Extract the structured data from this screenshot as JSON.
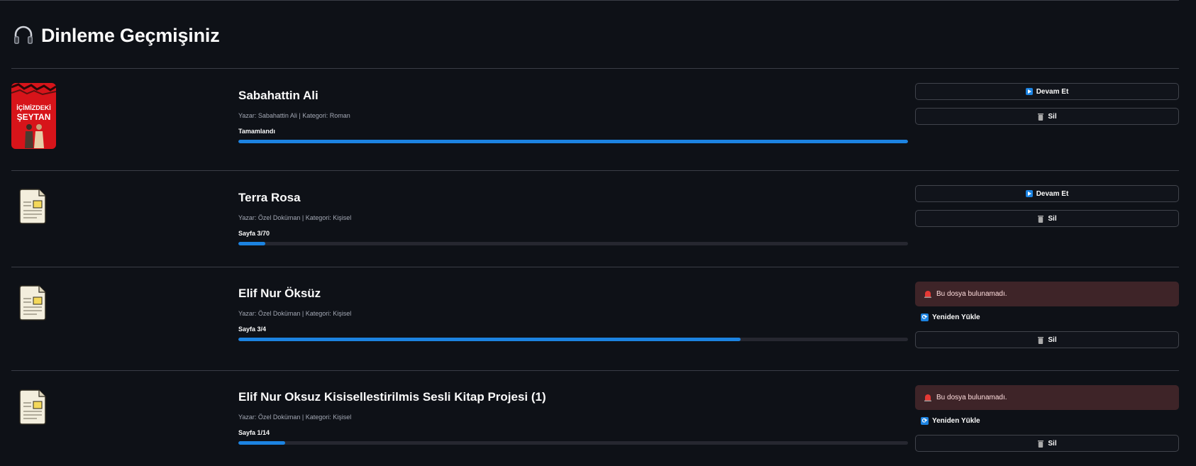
{
  "header": {
    "title": "Dinleme Geçmişiniz",
    "icon": "headphones-icon"
  },
  "entries": [
    {
      "title": "Sabahattin Ali",
      "meta": "Yazar: Sabahattin Ali | Kategori: Roman",
      "status": "Tamamlandı",
      "progress": 1.0,
      "cover_text": [
        "İÇİMİZDEKİ",
        "ŞEYTAN"
      ],
      "cover_color": "#d7141a",
      "continue_label": "Devam Et",
      "delete_label": "Sil"
    },
    {
      "title": "Terra Rosa",
      "meta": "Yazar: Özel Doküman | Kategori: Kişisel",
      "status": "Sayfa 3/70",
      "progress": 0.04,
      "continue_label": "Devam Et",
      "delete_label": "Sil"
    },
    {
      "title": "Elif Nur Öksüz",
      "meta": "Yazar: Özel Doküman | Kategori: Kişisel",
      "status": "Sayfa 3/4",
      "progress": 0.75,
      "error": "Bu dosya bulunamadı.",
      "reload_label": "Yeniden Yükle",
      "delete_label": "Sil"
    },
    {
      "title": "Elif Nur Oksuz Kisisellestirilmis Sesli Kitap Projesi (1)",
      "meta": "Yazar: Özel Doküman | Kategori: Kişisel",
      "status": "Sayfa 1/14",
      "progress": 0.07,
      "error": "Bu dosya bulunamadı.",
      "reload_label": "Yeniden Yükle",
      "delete_label": "Sil"
    }
  ],
  "colors": {
    "background": "#0e1117",
    "accent": "#1c83e1",
    "error_bg": "#3e2428",
    "track": "#262730"
  }
}
